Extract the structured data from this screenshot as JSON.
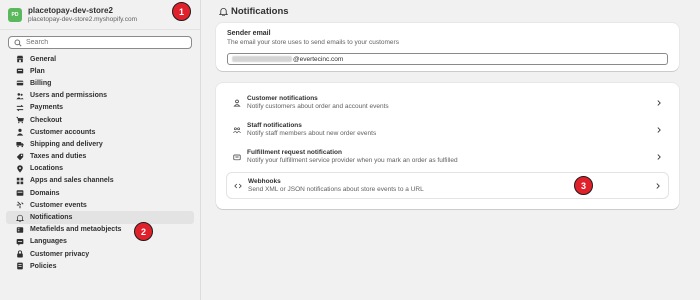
{
  "store": {
    "avatar_initials": "PD",
    "name": "placetopay-dev-store2",
    "url": "placetopay-dev-store2.myshopify.com"
  },
  "search": {
    "placeholder": "Search"
  },
  "nav": [
    {
      "label": "General",
      "icon": "store-icon"
    },
    {
      "label": "Plan",
      "icon": "plan-icon"
    },
    {
      "label": "Billing",
      "icon": "billing-icon"
    },
    {
      "label": "Users and permissions",
      "icon": "users-icon"
    },
    {
      "label": "Payments",
      "icon": "payments-icon"
    },
    {
      "label": "Checkout",
      "icon": "cart-icon"
    },
    {
      "label": "Customer accounts",
      "icon": "person-icon"
    },
    {
      "label": "Shipping and delivery",
      "icon": "truck-icon"
    },
    {
      "label": "Taxes and duties",
      "icon": "tax-icon"
    },
    {
      "label": "Locations",
      "icon": "location-icon"
    },
    {
      "label": "Apps and sales channels",
      "icon": "apps-icon"
    },
    {
      "label": "Domains",
      "icon": "globe-icon"
    },
    {
      "label": "Customer events",
      "icon": "events-icon"
    },
    {
      "label": "Notifications",
      "icon": "bell-icon",
      "active": true
    },
    {
      "label": "Metafields and metaobjects",
      "icon": "metafields-icon"
    },
    {
      "label": "Languages",
      "icon": "language-icon"
    },
    {
      "label": "Customer privacy",
      "icon": "lock-icon"
    },
    {
      "label": "Policies",
      "icon": "policies-icon"
    }
  ],
  "page": {
    "title": "Notifications"
  },
  "sender": {
    "title": "Sender email",
    "subtitle": "The email your store uses to send emails to your customers",
    "email_suffix": "@evertecinc.com"
  },
  "notifications": [
    {
      "title": "Customer notifications",
      "desc": "Notify customers about order and account events",
      "icon": "person-icon"
    },
    {
      "title": "Staff notifications",
      "desc": "Notify staff members about new order events",
      "icon": "staff-icon"
    },
    {
      "title": "Fulfillment request notification",
      "desc": "Notify your fulfillment service provider when you mark an order as fulfilled",
      "icon": "fulfillment-icon"
    },
    {
      "title": "Webhooks",
      "desc": "Send XML or JSON notifications about store events to a URL",
      "icon": "code-icon"
    }
  ],
  "callouts": [
    "1",
    "2",
    "3"
  ],
  "colors": {
    "callout": "#e0212b",
    "store_avatar": "#5cb85c",
    "active_nav": "#e3e3e3"
  }
}
